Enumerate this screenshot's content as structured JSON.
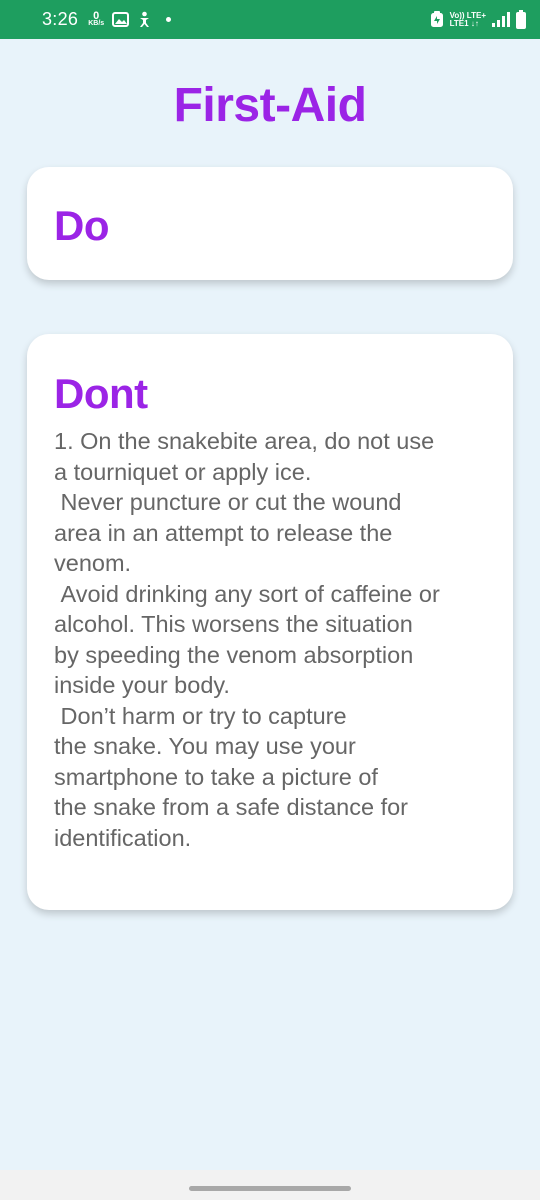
{
  "status_bar": {
    "time": "3:26",
    "net_speed_value": "0",
    "net_speed_unit": "KB/s",
    "volte_line1": "Vo)) LTE+",
    "volte_line2": "LTE1 ↓↑",
    "icons": [
      "image-icon",
      "accessibility-icon",
      "dot-icon",
      "battery-saver-icon",
      "signal-icon",
      "battery-icon"
    ]
  },
  "header": {
    "title": "First-Aid"
  },
  "do_card": {
    "title": "Do"
  },
  "dont_card": {
    "title": "Dont",
    "body": "1. On the snakebite area, do not use\na tourniquet or apply ice.\n Never puncture or cut the wound\narea in an attempt to release the\nvenom.\n Avoid drinking any sort of caffeine or\nalcohol. This worsens the situation\nby speeding the venom absorption\ninside your body.\n Don’t harm or try to capture\nthe snake. You may use your\nsmartphone to take a picture of\nthe snake from a safe distance for\nidentification."
  },
  "colors": {
    "status_bar": "#1e9e5f",
    "background": "#e8f3fa",
    "accent": "#9b24e6",
    "body_text": "#666666",
    "card": "#ffffff"
  }
}
